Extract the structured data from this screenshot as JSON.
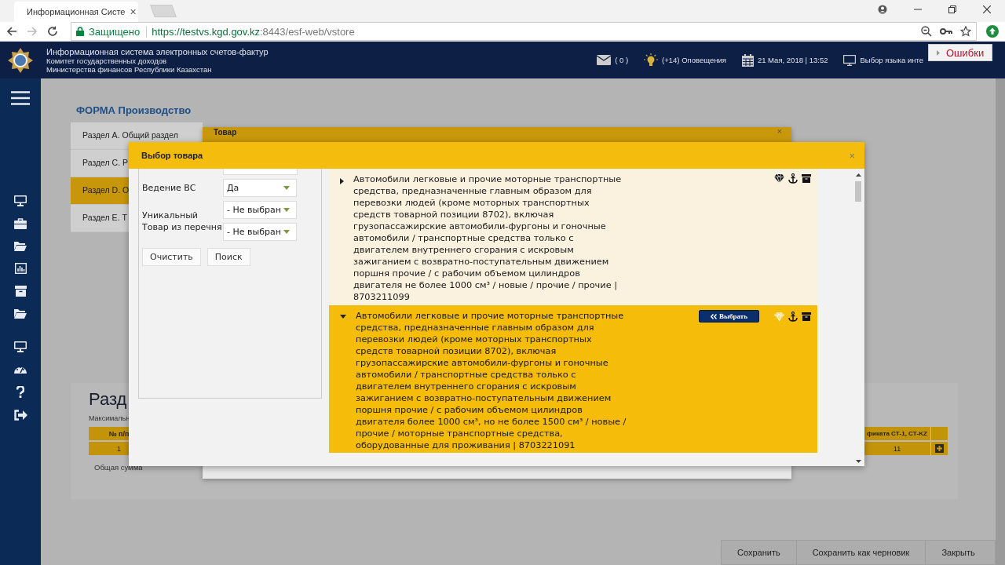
{
  "browser": {
    "tab_title": "Информационная Систе",
    "tab_close": "×",
    "secure_label": "Защищено",
    "url_host": "https://testvs.kgd.gov.kz",
    "url_rest": ":8443/esf-web/vstore"
  },
  "header": {
    "title": "Информационная система электронных счетов-фактур",
    "subtitle_1": "Комитет государственных доходов",
    "subtitle_2": "Министерства финансов Республики Казахстан",
    "messages": "( 0 )",
    "notifications": "(+14) Оповещения",
    "datetime": "21 Мая, 2018 | 13:52",
    "language": "Выбор языка инте"
  },
  "errors_popup": {
    "label": "Ошибки"
  },
  "form": {
    "title": "ФОРМА Производство",
    "sections": [
      {
        "label": "Раздел A. Общий раздел",
        "selected": false
      },
      {
        "label": "Раздел C. Р",
        "selected": false
      },
      {
        "label": "Раздел D. О",
        "selected": true
      },
      {
        "label": "Раздел E. Т",
        "selected": false
      }
    ]
  },
  "lower_panel": {
    "heading": "Разд",
    "caption": "Максимальн",
    "table": {
      "columns": [
        "№ п/п",
        "фиката СТ-1, СТ-KZ"
      ],
      "rows": [
        [
          "1",
          "11"
        ]
      ]
    },
    "total_label": "Общая сумма"
  },
  "footer_buttons": [
    "Сохранить",
    "Сохранить как черновик",
    "Закрыть"
  ],
  "back_dialog": {
    "title": "Товар",
    "close": "×"
  },
  "dialog": {
    "title": "Выбор товара",
    "close": "×",
    "filters": [
      {
        "label": "Ведение ВС",
        "selects": [
          "Да"
        ]
      },
      {
        "label": "Уникальный Товар из перечня",
        "selects": [
          "- Не выбран",
          "- Не выбран"
        ]
      }
    ],
    "buttons": [
      "Очистить",
      "Поиск"
    ],
    "items": [
      {
        "expanded": false,
        "selected": false,
        "text": "Автомобили легковые и прочие моторные транспортные средства, предназначенные главным образом для перевозки людей (кроме моторных транспортных средств товарной позиции 8702), включая грузопассажирские автомобили-фургоны и гоночные автомобили / транспортные средства только с двигателем внутреннего сгорания с искровым зажиганием с возвратно-поступательным движением поршня прочие / с рабочим объемом цилиндров двигателя не более 1000 см³ / новые / прочие / прочие | 8703211099"
      },
      {
        "expanded": true,
        "selected": true,
        "select_button": "Выбрать",
        "text": "Автомобили легковые и прочие моторные транспортные средства, предназначенные главным образом для перевозки людей (кроме моторных транспортных средств товарной позиции 8702), включая грузопассажирские автомобили-фургоны и гоночные автомобили / транспортные средства только с двигателем внутреннего сгорания с искровым зажиганием с возвратно-поступательным движением поршня прочие / с рабочим объемом цилиндров двигателя более 1000 см³, но не более 1500 см³ / новые / прочие / моторные транспортные средства, оборудованные для проживания | 8703221091"
      }
    ]
  }
}
